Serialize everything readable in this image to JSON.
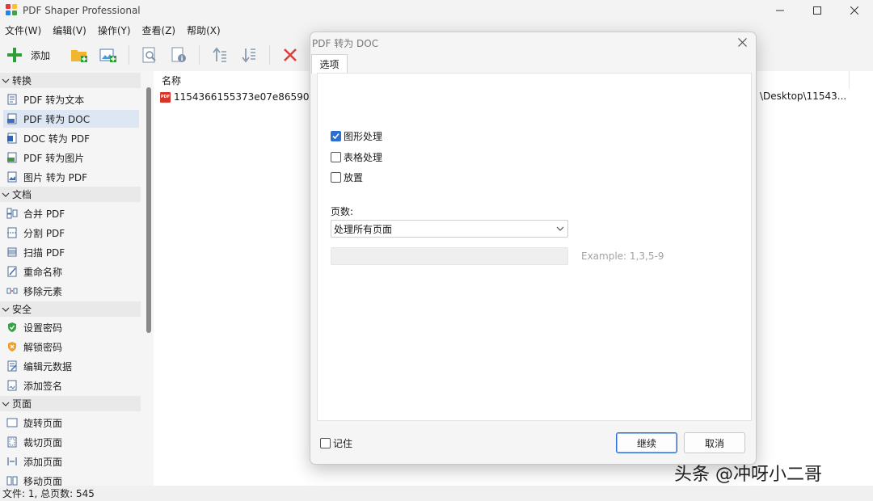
{
  "window": {
    "title": "PDF Shaper Professional"
  },
  "menu": [
    "文件(W)",
    "编辑(V)",
    "操作(Y)",
    "查看(Z)",
    "帮助(X)"
  ],
  "toolbar": {
    "add_label": "添加",
    "icons": [
      "plus-icon",
      "add-folder-icon",
      "add-image-icon",
      "preview-icon",
      "info-icon",
      "move-up-icon",
      "move-down-icon",
      "delete-icon"
    ]
  },
  "sidebar": {
    "groups": [
      {
        "label": "转换",
        "items": [
          {
            "label": "PDF 转为文本",
            "icon": "pdf-text-icon"
          },
          {
            "label": "PDF 转为 DOC",
            "icon": "pdf-doc-icon",
            "selected": true
          },
          {
            "label": "DOC 转为 PDF",
            "icon": "doc-pdf-icon"
          },
          {
            "label": "PDF 转为图片",
            "icon": "pdf-image-icon"
          },
          {
            "label": "图片 转为 PDF",
            "icon": "image-pdf-icon"
          }
        ]
      },
      {
        "label": "文档",
        "items": [
          {
            "label": "合并 PDF",
            "icon": "merge-icon"
          },
          {
            "label": "分割 PDF",
            "icon": "split-icon"
          },
          {
            "label": "扫描 PDF",
            "icon": "scan-icon"
          },
          {
            "label": "重命名称",
            "icon": "rename-icon"
          },
          {
            "label": "移除元素",
            "icon": "remove-elements-icon"
          }
        ]
      },
      {
        "label": "安全",
        "items": [
          {
            "label": "设置密码",
            "icon": "shield-green-icon"
          },
          {
            "label": "解锁密码",
            "icon": "shield-orange-icon"
          },
          {
            "label": "编辑元数据",
            "icon": "edit-metadata-icon"
          },
          {
            "label": "添加签名",
            "icon": "signature-icon"
          }
        ]
      },
      {
        "label": "页面",
        "items": [
          {
            "label": "旋转页面",
            "icon": "rotate-page-icon"
          },
          {
            "label": "裁切页面",
            "icon": "crop-page-icon"
          },
          {
            "label": "添加页面",
            "icon": "add-page-icon"
          },
          {
            "label": "移动页面",
            "icon": "move-page-icon"
          }
        ]
      }
    ]
  },
  "filelist": {
    "column_name": "名称",
    "files": [
      {
        "name": "1154366155373e07e86590b",
        "path": "\\Desktop\\11543..."
      }
    ]
  },
  "status": {
    "text": "文件: 1, 总页数: 545"
  },
  "watermark": "头条 @冲呀小二哥",
  "dialog": {
    "title": "PDF 转为 DOC",
    "tab": "选项",
    "options": [
      {
        "label": "图形处理",
        "checked": true
      },
      {
        "label": "表格处理",
        "checked": false
      },
      {
        "label": "放置",
        "checked": false
      }
    ],
    "pages_label": "页数:",
    "pages_select": "处理所有页面",
    "range_value": "",
    "example": "Example: 1,3,5-9",
    "remember_label": "记住",
    "remember_checked": false,
    "continue_label": "继续",
    "cancel_label": "取消"
  }
}
